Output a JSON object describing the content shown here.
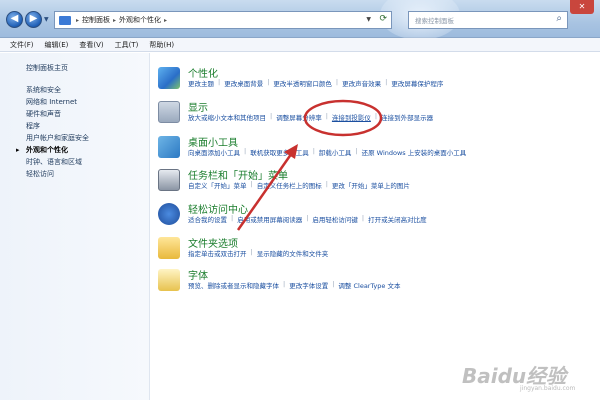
{
  "window": {
    "breadcrumb": [
      "控制面板",
      "外观和个性化"
    ],
    "search_placeholder": "搜索控制面板",
    "close_label": "✕"
  },
  "menu": [
    "文件(F)",
    "编辑(E)",
    "查看(V)",
    "工具(T)",
    "帮助(H)"
  ],
  "sidebar": {
    "home": "控制面板主页",
    "items": [
      "系统和安全",
      "网络和 Internet",
      "硬件和声音",
      "程序",
      "用户帐户和家庭安全",
      "外观和个性化",
      "时钟、语言和区域",
      "轻松访问"
    ],
    "active_index": 5
  },
  "categories": [
    {
      "title": "个性化",
      "icon": "personalization-icon",
      "links": [
        "更改主题",
        "更改桌面背景",
        "更改半透明窗口颜色",
        "更改声音效果",
        "更改屏幕保护程序"
      ]
    },
    {
      "title": "显示",
      "icon": "display-icon",
      "links": [
        "放大或缩小文本和其他项目",
        "调整屏幕分辨率",
        "连接到投影仪",
        "连接到外部显示器"
      ],
      "highlight_index": 1
    },
    {
      "title": "桌面小工具",
      "icon": "gadgets-icon",
      "links": [
        "向桌面添加小工具",
        "联机获取更多小工具",
        "卸载小工具",
        "还原 Windows 上安装的桌面小工具"
      ]
    },
    {
      "title": "任务栏和「开始」菜单",
      "icon": "taskbar-icon",
      "links": [
        "自定义「开始」菜单",
        "自定义任务栏上的图标",
        "更改「开始」菜单上的图片"
      ]
    },
    {
      "title": "轻松访问中心",
      "icon": "ease-of-access-icon",
      "links": [
        "适合我的设置",
        "启用或禁用屏幕阅读器",
        "启用轻松访问键",
        "打开或关闭高对比度"
      ]
    },
    {
      "title": "文件夹选项",
      "icon": "folder-options-icon",
      "links": [
        "指定单击或双击打开",
        "显示隐藏的文件和文件夹"
      ]
    },
    {
      "title": "字体",
      "icon": "fonts-icon",
      "links": [
        "预览、删除或者显示和隐藏字体",
        "更改字体设置",
        "调整 ClearType 文本"
      ]
    }
  ],
  "annotation_color": "#c8312f",
  "watermark": "Baidu经验",
  "watermark_sub": "jingyan.baidu.com"
}
